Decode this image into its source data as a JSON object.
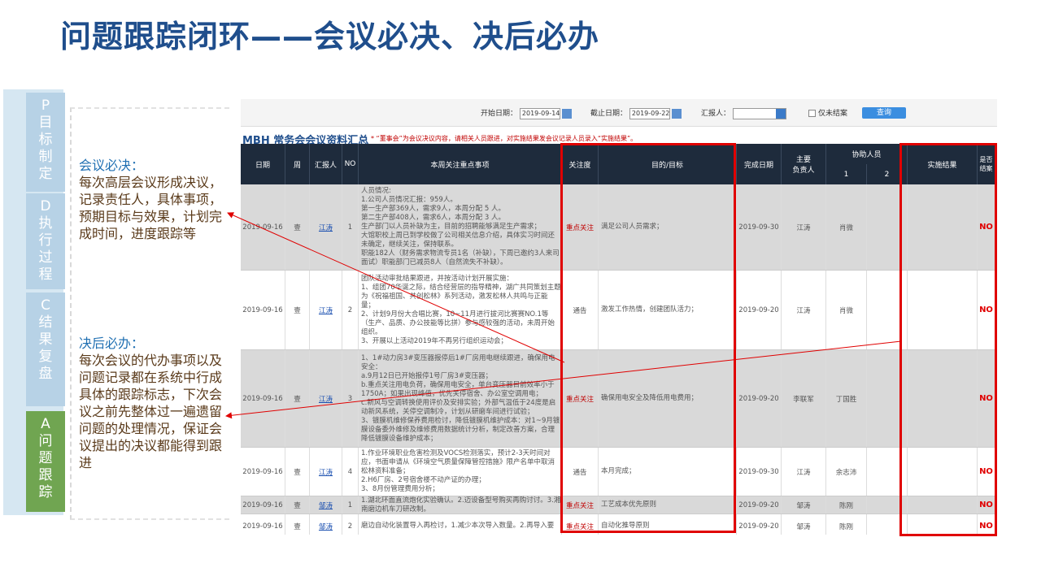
{
  "slide_title": "问题跟踪闭环——会议必决、决后必办",
  "pdca": [
    "P\n目\n标\n制\n定",
    "D\n执\n行\n过\n程",
    "C\n结\n果\n复\n盘",
    "A\n问\n题\n跟\n踪"
  ],
  "notes": {
    "n1_head": "会议必决：",
    "n1_body": "每次高层会议形成决议，记录责任人，具体事项，预期目标与效果，计划完成时间，进度跟踪等",
    "n2_head": "决后必办：",
    "n2_body": "每次会议的代办事项以及问题记录都在系统中行成具体的跟踪标志，下次会议之前先整体过一遍遗留问题的处理情况，保证会议提出的决议都能得到跟进"
  },
  "filter": {
    "start_label": "开始日期：",
    "start_value": "2019-09-14",
    "end_label": "截止日期：",
    "end_value": "2019-09-22",
    "reporter_label": "汇报人：",
    "unclosed_label": "仅未结案",
    "query_label": "查询"
  },
  "sheet_title": "MBH 常务会会议资料汇总",
  "sheet_note": "* “董事会”为会议决议内容，请相关人员跟进，对实施结果发会议记录人员录入“实施结果”。",
  "headers": {
    "date": "日期",
    "week": "周",
    "reporter": "汇报人",
    "no": "NO",
    "focus": "本周关注重点事项",
    "attention": "关注度",
    "goal": "目的/目标",
    "finish": "完成日期",
    "owner": "主要\n负责人",
    "assist": "协助人员",
    "assist1": "1",
    "assist2": "2",
    "result": "实施结果",
    "closed": "是否\n结案"
  },
  "rows": [
    {
      "date": "2019-09-16",
      "week": "壹",
      "reporter": "江涛",
      "no": "1",
      "focus": "人员情况:\n1.公司人员情况汇报：959人。\n第一生产部369人，需求9人，本周分配 5 人。\n第二生产部408人，需求6人，本周分配 3 人。\n生产部门以人员补缺为主，目前的招聘能够满足生产需求；\n大馆职校上周已到学校做了公司相关信息介绍，具体实习时间还未确定，继续关注，保持联系。\n职能182人（财务需求物流专员1名（补缺），下周已邀约3人来司面试）职能部门已减员8人（自然流失不补缺）。",
      "attention": "重点关注",
      "goal": "满足公司人员需求；",
      "finish": "2019-09-30",
      "owner": "江涛",
      "assist1": "肖微",
      "assist2": "",
      "result": "",
      "closed": "NO"
    },
    {
      "date": "2019-09-16",
      "week": "壹",
      "reporter": "江涛",
      "no": "2",
      "focus": "团队活动审批结果跟进，并按活动计划开展实施：\n1、组团70华诞之际，结合经营层的指导精神，湖广共同策划主题为《祝福祖国、共创松林》系列活动，激发松林人共鸣与正能量；\n2、计划9月份大合唱比赛，10~11月进行拔河比赛赛NO.1等（生产、品质、办公技能等比拼）参与感较强的活动，未周开始组织。\n3、开展以上活动2019年不再另行组织运动会；",
      "attention": "通告",
      "goal": "激发工作热情，创建团队活力；",
      "finish": "2019-09-20",
      "owner": "江涛",
      "assist1": "肖微",
      "assist2": "",
      "result": "",
      "closed": "NO"
    },
    {
      "date": "2019-09-16",
      "week": "壹",
      "reporter": "江涛",
      "no": "3",
      "focus": "1、1#动力房3#变压器报停后1#厂房用电继续跟进，确保用电安全：\na.9月12日已开始报停1号厂房3#变压器；\nb.重点关注用电负荷，确保用电安全，单台变压器目前效率小于1750A；如果出现峰值，优先关停宿舍、办公室空调用电；\nc.新风与空调转换使用评价及安排实验；外部气温低于24度是启动新风系统，关停空调制冷，计划从研磨车间进行试验；\n3、镀膜机维修保养费用检讨，降低镀膜机维护成本：对1~9月镀膜设备委外维修及维修费用数据统计分析，制定改善方案，合理降低镀膜设备维护成本；",
      "attention": "重点关注",
      "goal": "确保用电安全及降低用电费用；",
      "finish": "2019-09-20",
      "owner": "李联军",
      "assist1": "丁国胜",
      "assist2": "",
      "result": "",
      "closed": "NO"
    },
    {
      "date": "2019-09-16",
      "week": "壹",
      "reporter": "江涛",
      "no": "4",
      "focus": "1.作业环境职业危害检测及VOCS检测落实，预计2-3天时间对应，书面申请从《环境空气质量保障管控措施》限产名单中取消松林资料准备；\n2.H6厂房、2号宿舍楼不动产证的办理；\n3、8月份管理费用分析；",
      "attention": "通告",
      "goal": "本月完成；",
      "finish": "2019-09-30",
      "owner": "江涛",
      "assist1": "余志沛",
      "assist2": "",
      "result": "",
      "closed": "NO"
    },
    {
      "date": "2019-09-16",
      "week": "壹",
      "reporter": "邹涛",
      "no": "1",
      "focus": "1.湖北环面直流炮化实验确认。2.迈设备型号购买再购讨讨。3.湘南磨边机车刀研改制。",
      "attention": "重点关注",
      "goal": "工艺成本优先原则",
      "finish": "2019-09-20",
      "owner": "邹涛",
      "assist1": "陈刚",
      "assist2": "",
      "result": "",
      "closed": "NO"
    },
    {
      "date": "2019-09-16",
      "week": "壹",
      "reporter": "邹涛",
      "no": "2",
      "focus": "磨边自动化装置导入再检讨，1.减少本次导入数量。2.再导入要",
      "attention": "重点关注",
      "goal": "自动化推导原则",
      "finish": "2019-09-20",
      "owner": "邹涛",
      "assist1": "陈刚",
      "assist2": "",
      "result": "",
      "closed": "NO"
    }
  ]
}
